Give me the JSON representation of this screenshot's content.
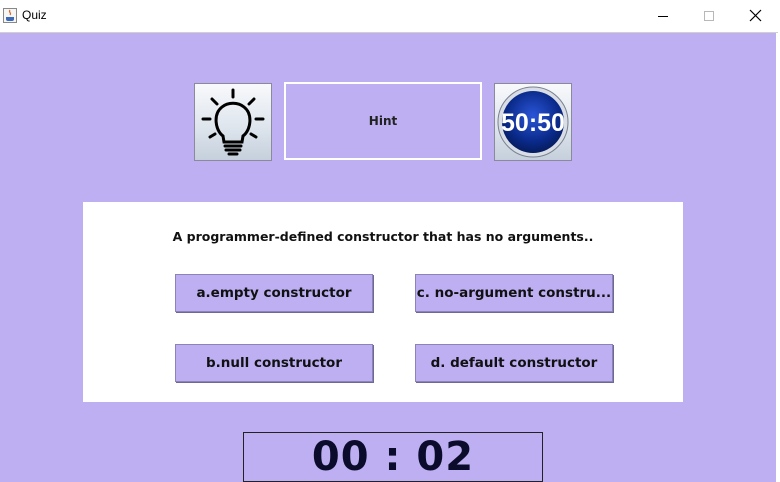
{
  "window": {
    "title": "Quiz",
    "controls": [
      "minimize",
      "maximize",
      "close"
    ]
  },
  "lifelines": {
    "hint_icon": "lightbulb-icon",
    "hint_label": "Hint",
    "fifty_label": "50:50"
  },
  "question": {
    "text": "A programmer-defined constructor that has no arguments..",
    "answers": [
      "a.empty constructor",
      "b.null constructor",
      "c. no-argument constru...",
      "d. default constructor"
    ]
  },
  "timer": {
    "display": "00 : 02"
  },
  "colors": {
    "background": "#bdaff2",
    "panel": "#ffffff",
    "fifty_badge": "#0a2a8a"
  }
}
